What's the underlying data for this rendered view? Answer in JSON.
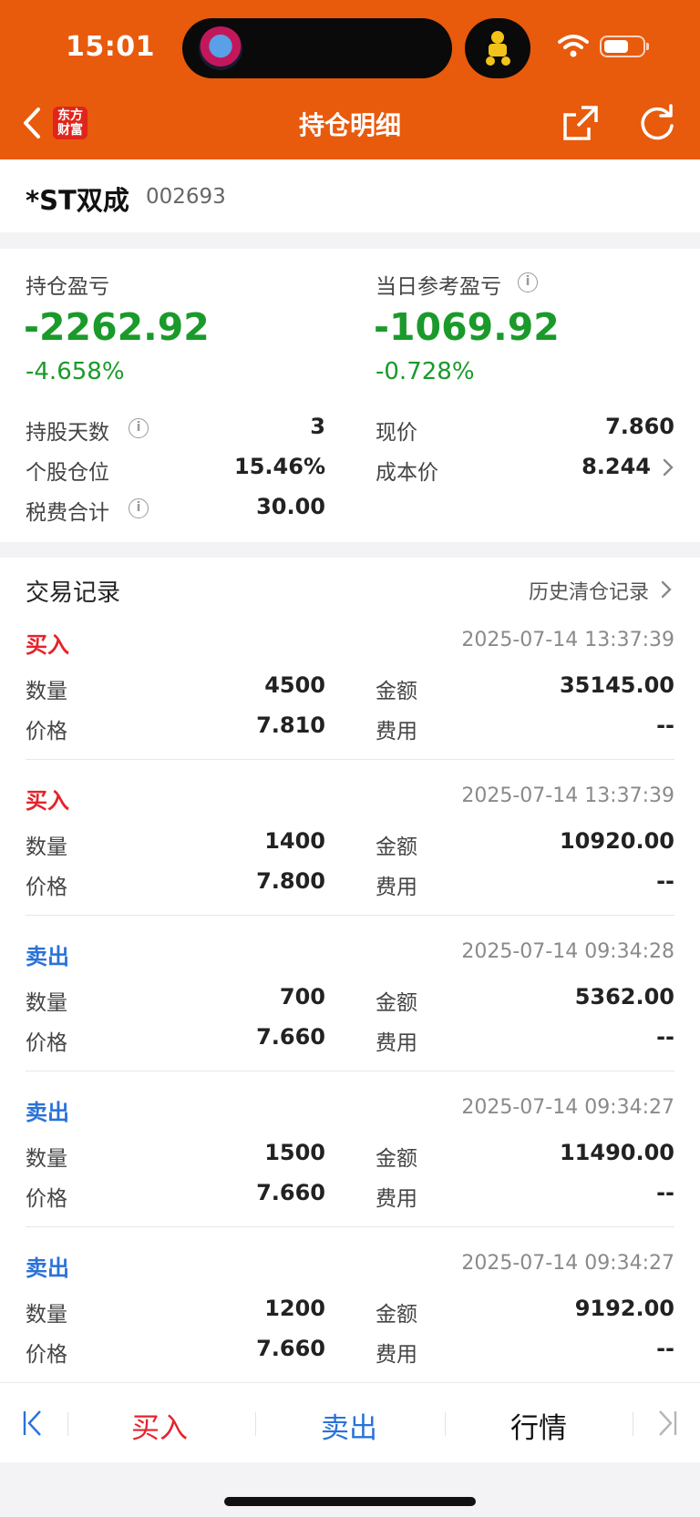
{
  "status": {
    "time": "15:01"
  },
  "nav": {
    "title": "持仓明细",
    "brand_line1": "东方",
    "brand_line2": "财富"
  },
  "stock": {
    "name": "*ST双成",
    "code": "002693"
  },
  "summary": {
    "position_pl_label": "持仓盈亏",
    "position_pl_value": "-2262.92",
    "position_pl_pct": "-4.658%",
    "daily_pl_label": "当日参考盈亏",
    "daily_pl_value": "-1069.92",
    "daily_pl_pct": "-0.728%",
    "holding_days_label": "持股天数",
    "holding_days_value": "3",
    "position_ratio_label": "个股仓位",
    "position_ratio_value": "15.46%",
    "fees_total_label": "税费合计",
    "fees_total_value": "30.00",
    "current_price_label": "现价",
    "current_price_value": "7.860",
    "cost_price_label": "成本价",
    "cost_price_value": "8.244",
    "info_glyph": "i"
  },
  "records": {
    "title": "交易记录",
    "history_link": "历史清仓记录",
    "labels": {
      "qty": "数量",
      "price": "价格",
      "amount": "金额",
      "fee": "费用"
    },
    "items": [
      {
        "side": "买入",
        "time": "2025-07-14 13:37:39",
        "qty": "4500",
        "price": "7.810",
        "amount": "35145.00",
        "fee": "--"
      },
      {
        "side": "买入",
        "time": "2025-07-14 13:37:39",
        "qty": "1400",
        "price": "7.800",
        "amount": "10920.00",
        "fee": "--"
      },
      {
        "side": "卖出",
        "time": "2025-07-14 09:34:28",
        "qty": "700",
        "price": "7.660",
        "amount": "5362.00",
        "fee": "--"
      },
      {
        "side": "卖出",
        "time": "2025-07-14 09:34:27",
        "qty": "1500",
        "price": "7.660",
        "amount": "11490.00",
        "fee": "--"
      },
      {
        "side": "卖出",
        "time": "2025-07-14 09:34:27",
        "qty": "1200",
        "price": "7.660",
        "amount": "9192.00",
        "fee": "--"
      }
    ]
  },
  "toolbar": {
    "buy_label": "买入",
    "sell_label": "卖出",
    "quote_label": "行情"
  },
  "colors": {
    "brand": "#e85a0c",
    "loss_green": "#1a9a2a",
    "buy_red": "#e5232b",
    "sell_blue": "#2a72d8"
  },
  "icons": [
    "back-icon",
    "share-icon",
    "refresh-icon",
    "info-icon",
    "chevron-right-icon",
    "first-page-icon",
    "last-page-icon",
    "wifi-icon",
    "battery-icon"
  ]
}
